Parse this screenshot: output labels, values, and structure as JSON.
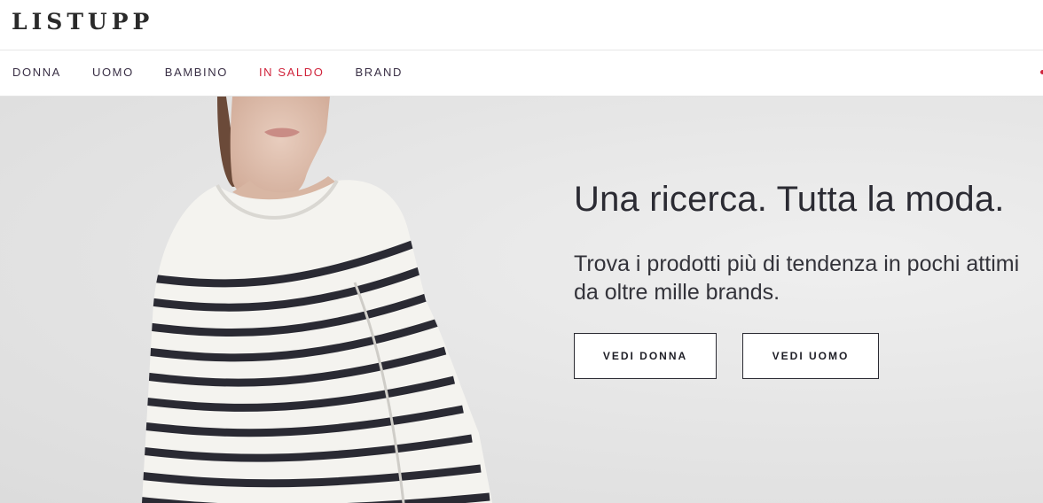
{
  "brand": {
    "logo_text": "LISTUPP"
  },
  "nav": {
    "items": [
      {
        "label": "DONNA"
      },
      {
        "label": "UOMO"
      },
      {
        "label": "BAMBINO"
      },
      {
        "label": "IN SALDO",
        "highlight": true
      },
      {
        "label": "BRAND"
      }
    ],
    "highlight_color": "#d0243c",
    "text_color": "#3a3046"
  },
  "hero": {
    "headline": "Una ricerca. Tutta la moda.",
    "subline": "Trova i prodotti più di tendenza in pochi attimi da oltre mille brands.",
    "buttons": {
      "women_label": "VEDI DONNA",
      "men_label": "VEDI UOMO"
    },
    "image_subject": "model-in-striped-top"
  }
}
